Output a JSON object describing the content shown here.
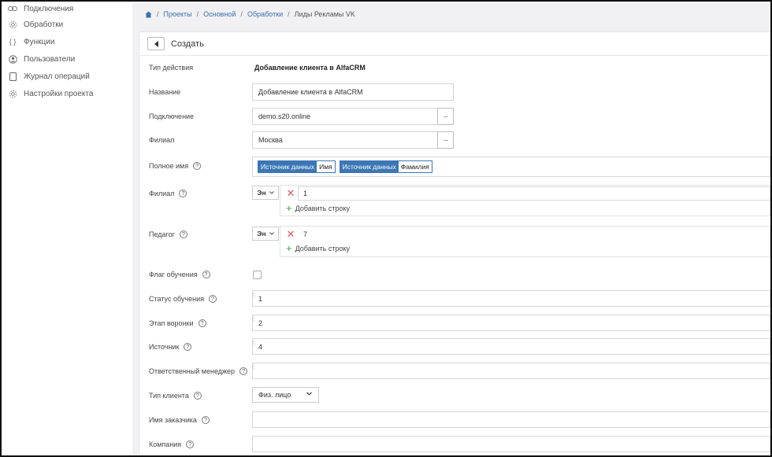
{
  "sidebar": {
    "items": [
      {
        "label": "Подключения",
        "icon": "link-icon"
      },
      {
        "label": "Обработки",
        "icon": "gear-icon"
      },
      {
        "label": "Функции",
        "icon": "braces-icon"
      },
      {
        "label": "Пользователи",
        "icon": "user-icon"
      },
      {
        "label": "Журнал операций",
        "icon": "journal-icon"
      },
      {
        "label": "Настройки проекта",
        "icon": "settings-icon"
      }
    ]
  },
  "breadcrumb": {
    "home_icon": "home-icon",
    "items": [
      "Проекты",
      "Основной",
      "Обработки"
    ],
    "current": "Лиды Рекламы VK",
    "separator": "/"
  },
  "header": {
    "title": "Создать"
  },
  "form": {
    "action_type": {
      "label": "Тип действия",
      "value": "Добавление клиента в AlfaCRM"
    },
    "name": {
      "label": "Название",
      "value": "Добавление клиента в AlfaCRM"
    },
    "connection": {
      "label": "Подключение",
      "value": "demo.s20.online",
      "button": "···"
    },
    "branch": {
      "label": "Филиал",
      "value": "Москва",
      "button": "···"
    },
    "full_name": {
      "label": "Полное имя",
      "help": "?",
      "tags": [
        {
          "source": "Источник данных",
          "field": "Имя"
        },
        {
          "source": "Источник данных",
          "field": "Фамилия"
        }
      ]
    },
    "branch_list": {
      "label": "Филиал",
      "help": "?",
      "mode": "Эн",
      "rows": [
        "1"
      ],
      "add": "Добавить строку"
    },
    "teacher_list": {
      "label": "Педагог",
      "help": "?",
      "mode": "Эн",
      "rows": [
        "7"
      ],
      "add": "Добавить строку"
    },
    "study_flag": {
      "label": "Флаг обучения",
      "help": "?",
      "checked": false
    },
    "study_status": {
      "label": "Статус обучения",
      "help": "?",
      "value": "1"
    },
    "funnel_stage": {
      "label": "Этап воронки",
      "help": "?",
      "value": "2"
    },
    "source": {
      "label": "Источник",
      "help": "?",
      "value": "4"
    },
    "manager": {
      "label": "Ответственный менеджер",
      "help": "?",
      "value": ""
    },
    "client_type": {
      "label": "Тип клиента",
      "help": "?",
      "value": "Физ. лицо"
    },
    "customer_name": {
      "label": "Имя заказчика",
      "help": "?",
      "value": ""
    },
    "company": {
      "label": "Компания",
      "help": "?",
      "value": ""
    }
  },
  "colors": {
    "accent": "#3b76b5",
    "link": "#3a6fb0",
    "delete": "#e05a5a",
    "add": "#3aa34a"
  }
}
